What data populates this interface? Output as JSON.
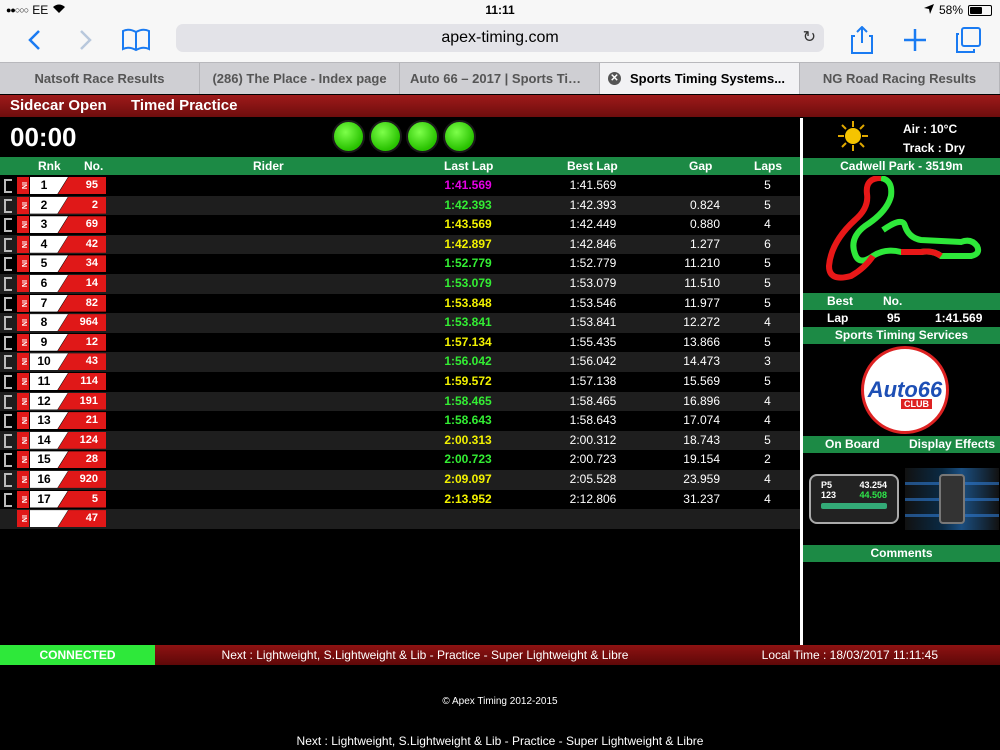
{
  "status_bar": {
    "carrier": "EE",
    "time": "11:11",
    "battery": "58%",
    "battery_level": 0.58
  },
  "browser": {
    "url": "apex-timing.com",
    "tabs": [
      {
        "label": "Natsoft Race Results"
      },
      {
        "label": "(286) The Place - Index page"
      },
      {
        "label": "Auto 66 – 2017 | Sports Tim..."
      },
      {
        "label": "Sports Timing Systems..."
      },
      {
        "label": "NG Road Racing Results"
      }
    ],
    "active_tab": 3
  },
  "race": {
    "class": "Sidecar Open",
    "session": "Timed Practice",
    "clock": "00:00"
  },
  "colors": {
    "header_red": "#9e1a1a",
    "green": "#1c8a45",
    "magenta": "#e600e6",
    "lime": "#33ee33",
    "yellow": "#f2f200"
  },
  "table": {
    "headers": {
      "rank": "Rnk",
      "no": "No.",
      "rider": "Rider",
      "last_lap": "Last Lap",
      "best_lap": "Best Lap",
      "gap": "Gap",
      "laps": "Laps"
    },
    "in_label": "IN",
    "rows": [
      {
        "rank": "1",
        "no": "95",
        "last": "1:41.569",
        "color": "#e600e6",
        "best": "1:41.569",
        "gap": "",
        "laps": "5"
      },
      {
        "rank": "2",
        "no": "2",
        "last": "1:42.393",
        "color": "#33ee33",
        "best": "1:42.393",
        "gap": "0.824",
        "laps": "5"
      },
      {
        "rank": "3",
        "no": "69",
        "last": "1:43.569",
        "color": "#f2f200",
        "best": "1:42.449",
        "gap": "0.880",
        "laps": "4"
      },
      {
        "rank": "4",
        "no": "42",
        "last": "1:42.897",
        "color": "#f2f200",
        "best": "1:42.846",
        "gap": "1.277",
        "laps": "6"
      },
      {
        "rank": "5",
        "no": "34",
        "last": "1:52.779",
        "color": "#33ee33",
        "best": "1:52.779",
        "gap": "11.210",
        "laps": "5"
      },
      {
        "rank": "6",
        "no": "14",
        "last": "1:53.079",
        "color": "#33ee33",
        "best": "1:53.079",
        "gap": "11.510",
        "laps": "5"
      },
      {
        "rank": "7",
        "no": "82",
        "last": "1:53.848",
        "color": "#f2f200",
        "best": "1:53.546",
        "gap": "11.977",
        "laps": "5"
      },
      {
        "rank": "8",
        "no": "964",
        "last": "1:53.841",
        "color": "#33ee33",
        "best": "1:53.841",
        "gap": "12.272",
        "laps": "4"
      },
      {
        "rank": "9",
        "no": "12",
        "last": "1:57.134",
        "color": "#f2f200",
        "best": "1:55.435",
        "gap": "13.866",
        "laps": "5"
      },
      {
        "rank": "10",
        "no": "43",
        "last": "1:56.042",
        "color": "#33ee33",
        "best": "1:56.042",
        "gap": "14.473",
        "laps": "3"
      },
      {
        "rank": "11",
        "no": "114",
        "last": "1:59.572",
        "color": "#f2f200",
        "best": "1:57.138",
        "gap": "15.569",
        "laps": "5"
      },
      {
        "rank": "12",
        "no": "191",
        "last": "1:58.465",
        "color": "#33ee33",
        "best": "1:58.465",
        "gap": "16.896",
        "laps": "4"
      },
      {
        "rank": "13",
        "no": "21",
        "last": "1:58.643",
        "color": "#33ee33",
        "best": "1:58.643",
        "gap": "17.074",
        "laps": "4"
      },
      {
        "rank": "14",
        "no": "124",
        "last": "2:00.313",
        "color": "#f2f200",
        "best": "2:00.312",
        "gap": "18.743",
        "laps": "5"
      },
      {
        "rank": "15",
        "no": "28",
        "last": "2:00.723",
        "color": "#33ee33",
        "best": "2:00.723",
        "gap": "19.154",
        "laps": "2"
      },
      {
        "rank": "16",
        "no": "920",
        "last": "2:09.097",
        "color": "#f2f200",
        "best": "2:05.528",
        "gap": "23.959",
        "laps": "4"
      },
      {
        "rank": "17",
        "no": "5",
        "last": "2:13.952",
        "color": "#f2f200",
        "best": "2:12.806",
        "gap": "31.237",
        "laps": "4"
      },
      {
        "rank": "",
        "no": "47",
        "last": "",
        "color": "#fff",
        "best": "",
        "gap": "",
        "laps": ""
      }
    ]
  },
  "panel": {
    "weather_icon": "sun-icon",
    "air": "Air : 10°C",
    "track": "Track : Dry",
    "circuit": "Cadwell Park - 3519m",
    "best": {
      "label_best": "Best",
      "label_no": "No.",
      "label_lap": "Lap",
      "no": "95",
      "time": "1:41.569"
    },
    "sponsor": "Sports Timing Services",
    "logo_text": "Auto66",
    "logo_club": "CLUB",
    "on_board": "On Board",
    "display_effects": "Display Effects",
    "phone": {
      "pos": "P5",
      "time1": "43.254",
      "car": "123",
      "time2": "44.508"
    },
    "comments": "Comments"
  },
  "bottom": {
    "connected": "CONNECTED",
    "next": "Next : Lightweight, S.Lightweight & Lib - Practice - Super Lightweight & Libre",
    "local_time": "Local Time : 18/03/2017 11:11:45",
    "copyright": "© Apex Timing 2012-2015",
    "footer_next": "Next : Lightweight, S.Lightweight & Lib - Practice - Super Lightweight & Libre"
  }
}
